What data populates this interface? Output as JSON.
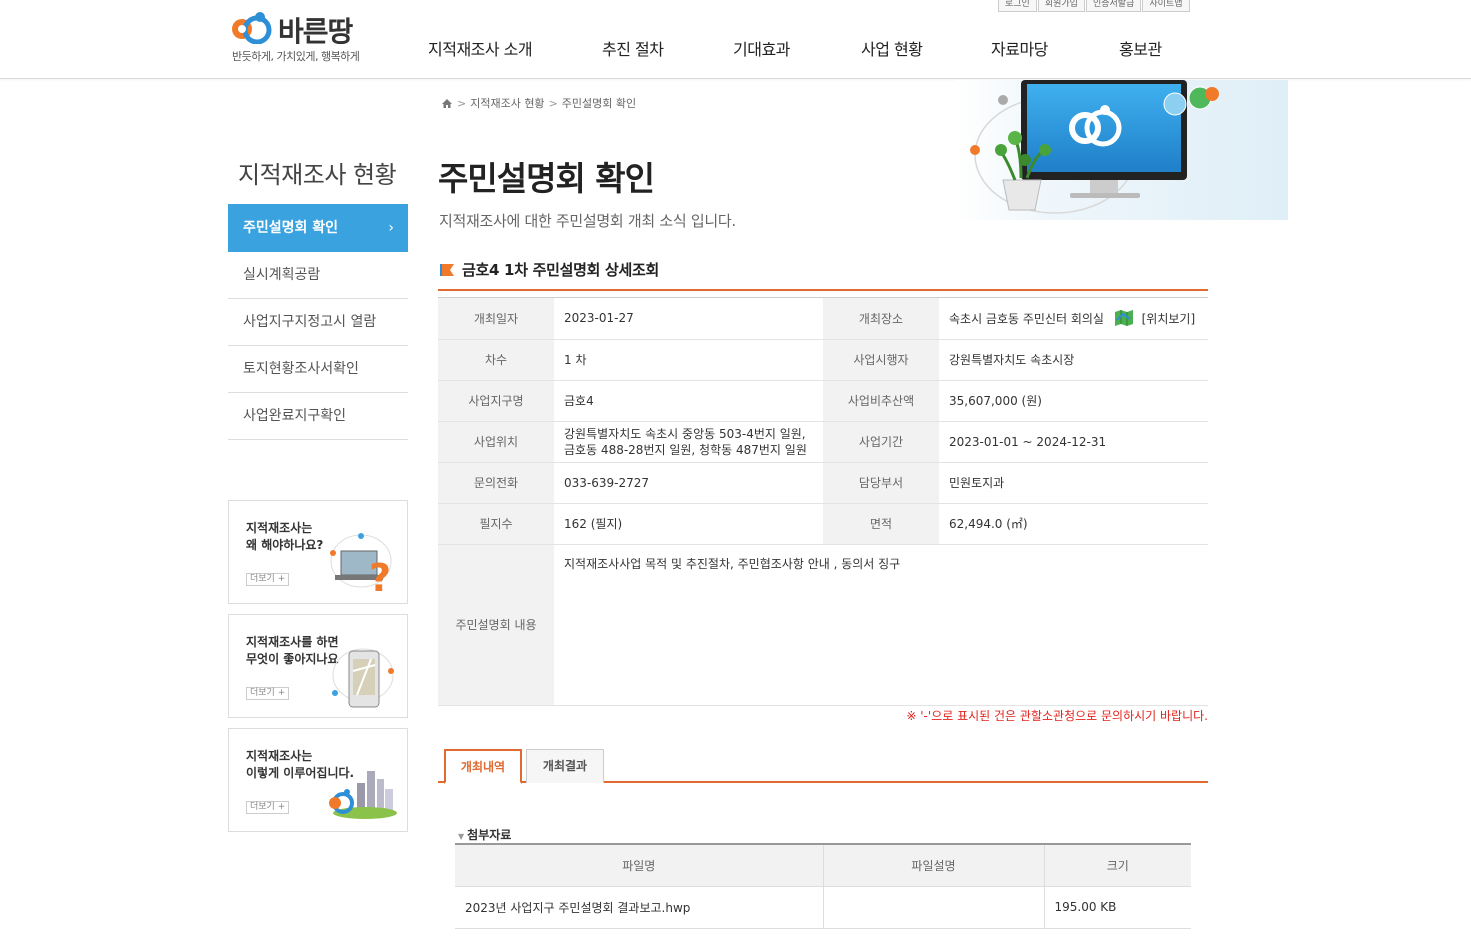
{
  "header": {
    "logo_name": "바른땅",
    "logo_slogan": "반듯하게, 가치있게, 행복하게",
    "util": [
      "로그인",
      "회원가입",
      "인증서발급",
      "사이트맵"
    ],
    "nav": [
      "지적재조사 소개",
      "추진 절차",
      "기대효과",
      "사업 현황",
      "자료마당",
      "홍보관"
    ]
  },
  "breadcrumb": [
    "지적재조사 현황",
    "주민설명회 확인"
  ],
  "sidebar": {
    "title": "지적재조사 현황",
    "items": [
      {
        "label": "주민설명회 확인",
        "arrow": "›"
      },
      {
        "label": "실시계획공람"
      },
      {
        "label": "사업지구지정고시 열람"
      },
      {
        "label": "토지현황조사서확인"
      },
      {
        "label": "사업완료지구확인"
      }
    ],
    "banners": [
      {
        "line1": "지적재조사는",
        "line2": "왜 해야하나요?",
        "more": "더보기 +"
      },
      {
        "line1": "지적재조사를 하면",
        "line2": "무엇이 좋아지나요",
        "more": "더보기 +"
      },
      {
        "line1": "지적재조사는",
        "line2": "이렇게 이루어집니다.",
        "more": "더보기 +"
      }
    ]
  },
  "page": {
    "title": "주민설명회 확인",
    "description": "지적재조사에 대한 주민설명회 개최 소식 입니다.",
    "section_title": "금호4 1차 주민설명회 상세조회"
  },
  "detail": {
    "date_label": "개최일자",
    "date": "2023-01-27",
    "place_label": "개최장소",
    "place": "속초시 금호동 주민신터 회의실",
    "map_link": "[위치보기]",
    "round_label": "차수",
    "round": "1 차",
    "operator_label": "사업시행자",
    "operator": "강원특별자치도 속초시장",
    "district_label": "사업지구명",
    "district": "금호4",
    "cost_label": "사업비추산액",
    "cost": "35,607,000 (원)",
    "location_label": "사업위치",
    "location": "강원특별자치도 속초시 중앙동 503-4번지 일원, 금호동 488-28번지 일원, 청학동 487번지 일원",
    "period_label": "사업기간",
    "period": "2023-01-01 ~ 2024-12-31",
    "phone_label": "문의전화",
    "phone": "033-639-2727",
    "dept_label": "담당부서",
    "dept": "민원토지과",
    "parcels_label": "필지수",
    "parcels": "162 (필지)",
    "area_label": "면적",
    "area": "62,494.0 (㎡)",
    "content_label": "주민설명회 내용",
    "content": "지적재조사사업 목적 및 추진절차, 주민협조사항 안내 , 동의서 징구"
  },
  "notice": "※ '-'으로 표시된 건은 관할소관청으로 문의하시기 바랍니다.",
  "tabs": [
    "개최내역",
    "개최결과"
  ],
  "attachments": {
    "label": "첨부자료",
    "headers": [
      "파일명",
      "파일설명",
      "크기"
    ],
    "rows": [
      {
        "name": "2023년 사업지구 주민설명회 결과보고.hwp",
        "desc": "",
        "size": "195.00 KB"
      }
    ]
  },
  "colors": {
    "accent": "#e06a2f",
    "menu_active": "#3aa3df",
    "notice": "#e3251f"
  }
}
